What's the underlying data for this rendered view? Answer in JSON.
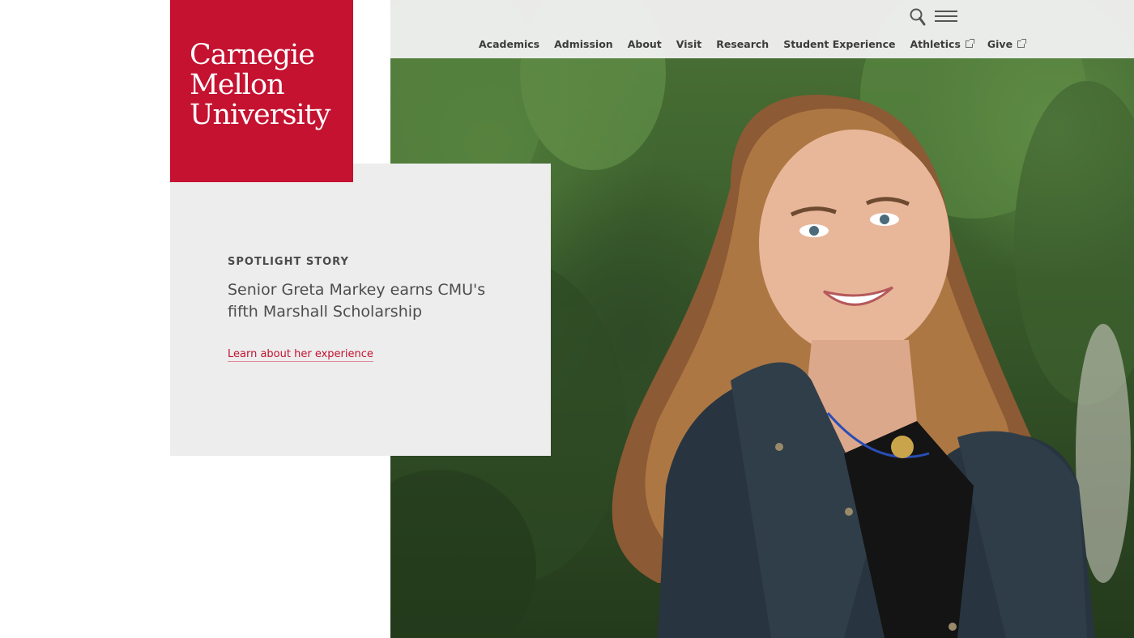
{
  "brand": {
    "logo_lines": [
      "Carnegie",
      "Mellon",
      "University"
    ],
    "logo_color": "#c41230"
  },
  "nav": {
    "items": [
      {
        "label": "Academics",
        "external": false
      },
      {
        "label": "Admission",
        "external": false
      },
      {
        "label": "About",
        "external": false
      },
      {
        "label": "Visit",
        "external": false
      },
      {
        "label": "Research",
        "external": false
      },
      {
        "label": "Student Experience",
        "external": false
      },
      {
        "label": "Athletics",
        "external": true
      },
      {
        "label": "Give",
        "external": true
      }
    ],
    "icons": [
      "search-icon",
      "menu-icon"
    ]
  },
  "spotlight": {
    "eyebrow": "SPOTLIGHT STORY",
    "headline": "Senior Greta Markey earns CMU's fifth Marshall Scholarship",
    "cta": "Learn about her experience",
    "accent": "#c41230"
  }
}
